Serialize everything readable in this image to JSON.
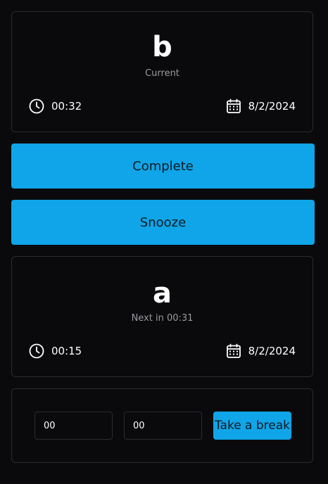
{
  "current_task": {
    "name": "b",
    "status_label": "Current",
    "duration": "00:32",
    "date": "8/2/2024"
  },
  "actions": {
    "complete_label": "Complete",
    "snooze_label": "Snooze"
  },
  "next_task": {
    "name": "a",
    "status_label": "Next in 00:31",
    "duration": "00:15",
    "date": "8/2/2024"
  },
  "break": {
    "hours_value": "00",
    "minutes_value": "00",
    "button_label": "Take a break"
  },
  "icons": {
    "duration": "clock-icon",
    "date": "calendar-icon"
  },
  "colors": {
    "background": "#0a0a0c",
    "card_border": "#2b2b30",
    "accent": "#10a5e8",
    "muted_text": "#9a9aa0"
  }
}
